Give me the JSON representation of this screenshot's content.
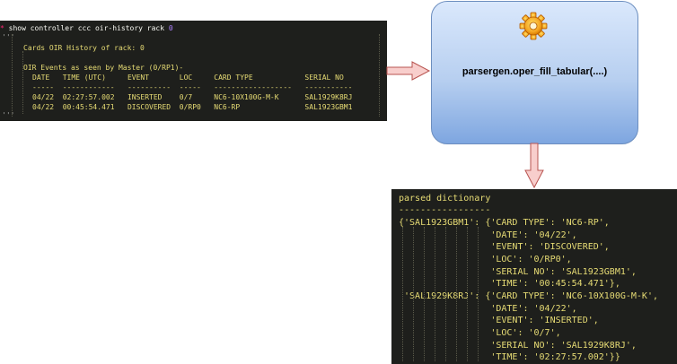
{
  "terminal": {
    "prompt_star": "*",
    "command": "show controller ccc oir-history rack ",
    "command_arg": "0",
    "quote_open": "'''",
    "cards_header": "Cards OIR History of rack: 0",
    "events_header": "OIR Events as seen by Master (0/RP1)-",
    "column_headers": "DATE   TIME (UTC)     EVENT       LOC     CARD TYPE            SERIAL NO",
    "separator": "-----  ------------   ----------  -----   ------------------   -----------",
    "rows": [
      "04/22  02:27:57.002   INSERTED    0/7     NC6-10X100G-M-K      SAL1929K8RJ",
      "04/22  00:45:54.471   DISCOVERED  0/RP0   NC6-RP               SAL1923GBM1"
    ],
    "quote_close": "'''"
  },
  "process_box": {
    "label": "parsergen.oper_fill_tabular(....)",
    "icon": "gear-icon"
  },
  "dictionary": {
    "title": "parsed dictionary",
    "underline": "-----------------",
    "lines": [
      "{'SAL1923GBM1': {'CARD TYPE': 'NC6-RP',",
      "                 'DATE': '04/22',",
      "                 'EVENT': 'DISCOVERED',",
      "                 'LOC': '0/RP0',",
      "                 'SERIAL NO': 'SAL1923GBM1',",
      "                 'TIME': '00:45:54.471'},",
      " 'SAL1929K8RJ': {'CARD TYPE': 'NC6-10X100G-M-K',",
      "                 'DATE': '04/22',",
      "                 'EVENT': 'INSERTED',",
      "                 'LOC': '0/7',",
      "                 'SERIAL NO': 'SAL1929K8RJ',",
      "                 'TIME': '02:27:57.002'}}"
    ]
  },
  "colors": {
    "terminal_bg": "#1e1f1c",
    "text_yellow": "#e6db74",
    "text_white": "#f8f8f2",
    "accent_red": "#f92672",
    "accent_purple": "#ae81ff",
    "arrow_fill": "#f8cecc",
    "arrow_stroke": "#b85450",
    "box_stroke": "#6c8ebf"
  }
}
